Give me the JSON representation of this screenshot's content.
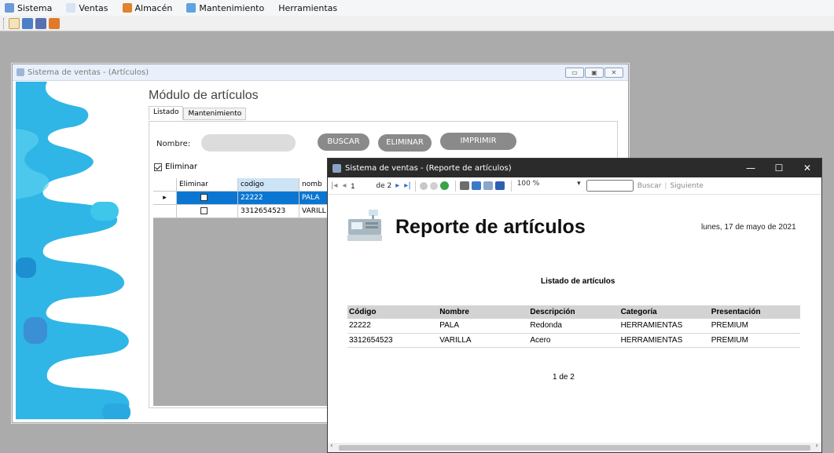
{
  "menu": {
    "items": [
      {
        "label": "Sistema",
        "icon": "system-icon",
        "color": "#6a9bd8"
      },
      {
        "label": "Ventas",
        "icon": "cart-icon",
        "color": "#7aa7d8"
      },
      {
        "label": "Almacén",
        "icon": "warehouse-icon",
        "color": "#e0822e"
      },
      {
        "label": "Mantenimiento",
        "icon": "tools-icon",
        "color": "#5fa3e0"
      },
      {
        "label": "Herramientas",
        "icon": "",
        "color": ""
      }
    ]
  },
  "toolbar": {
    "buttons": [
      {
        "icon": "new-doc-icon",
        "color": "#c8a050"
      },
      {
        "icon": "monitor-icon",
        "color": "#4b7fc8"
      },
      {
        "icon": "database-icon",
        "color": "#5a6fb0"
      },
      {
        "icon": "box-icon",
        "color": "#e07a2a"
      }
    ]
  },
  "articles_window": {
    "title": "Sistema de ventas - (Artículos)",
    "controls": {
      "minimize": "▭",
      "restore": "▣",
      "close": "✕"
    },
    "module_title": "Módulo de artículos",
    "tabs": [
      "Listado",
      "Mantenimiento"
    ],
    "nombre_label": "Nombre:",
    "nombre_value": "",
    "buttons": {
      "buscar": "BUSCAR",
      "eliminar": "ELIMINAR",
      "imprimir": "IMPRIMIR"
    },
    "eliminar_checkbox": "Eliminar",
    "grid": {
      "columns": [
        "Eliminar",
        "codigo",
        "nomb"
      ],
      "rows": [
        {
          "marker": "▸",
          "codigo": "22222",
          "nombre": "PALA"
        },
        {
          "marker": "",
          "codigo": "3312654523",
          "nombre": "VARILL"
        }
      ]
    }
  },
  "report_window": {
    "title": "Sistema de ventas - (Reporte de artículos)",
    "controls": {
      "minimize": "—",
      "maximize": "☐",
      "close": "✕"
    },
    "toolbar": {
      "first": "|◂",
      "prev": "◂",
      "page": "1",
      "of_pages": "de 2",
      "next": "▸",
      "last": "▸|",
      "zoom": "100 %",
      "zoom_arrow": "▾",
      "find": "Buscar",
      "find_sep": "|",
      "next_find": "Siguiente"
    },
    "heading": "Reporte de artículos",
    "date": "lunes, 17 de mayo de 2021",
    "subtitle": "Listado de artículos",
    "table": {
      "headers": [
        "Código",
        "Nombre",
        "Descripción",
        "Categoría",
        "Presentación"
      ],
      "rows": [
        [
          "22222",
          "PALA",
          "Redonda",
          "HERRAMIENTAS",
          "PREMIUM"
        ],
        [
          "3312654523",
          "VARILLA",
          "Acero",
          "HERRAMIENTAS",
          "PREMIUM"
        ]
      ]
    },
    "page_indicator": "1 de 2",
    "scroll_left": "‹",
    "scroll_right": "›"
  }
}
